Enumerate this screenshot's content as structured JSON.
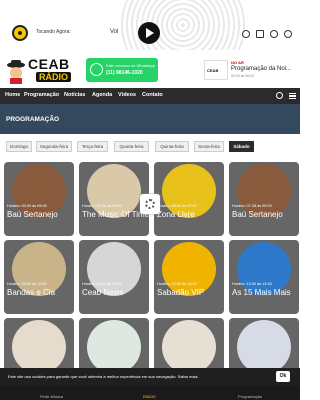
{
  "player": {
    "now_playing": "Tocando Agora:",
    "volume_label": "Vol"
  },
  "header": {
    "brand_main": "CEAB",
    "brand_sub": "RÁDIO",
    "whatsapp_line1": "Fale conosco no WhatsApp",
    "whatsapp_line2": "(11) 98146-1020",
    "onair_label": "NO AR",
    "onair_title": "Programação da Noi...",
    "onair_time": "00:00 às 06:00",
    "onair_thumb": "CEAB"
  },
  "nav": {
    "items": [
      "Home",
      "Programação",
      "Notícias",
      "Agenda",
      "Vídeos",
      "Contato"
    ]
  },
  "page": {
    "title": "PROGRAMAÇÃO"
  },
  "tabs": [
    "Domingo",
    "Segunda-feira",
    "Terça-feira",
    "Quarta-feira",
    "Quinta-feira",
    "Sexta-feira",
    "Sábado"
  ],
  "active_tab": "Sábado",
  "cards": [
    {
      "time": "Horário: 00:00 às 05:00",
      "name": "Baú Sertanejo"
    },
    {
      "time": "Horário: 04:00 às 05:00",
      "name": "The Music Of Time"
    },
    {
      "time": "Horário: 05:00 às 07:07",
      "name": "Zona Livre"
    },
    {
      "time": "Horário: 07:28 às 09:00",
      "name": "Baú Sertanejo"
    },
    {
      "time": "Horário: 09:00 às 11:00",
      "name": "Bandas e Cia"
    },
    {
      "time": "Horário: 11:00 às 12:00",
      "name": "Ceab News"
    },
    {
      "time": "Horário: 12:00 às 13:00",
      "name": "Sabadão VIP"
    },
    {
      "time": "Horário: 13:00 às 13:45",
      "name": "As 15 Mais Mais"
    },
    {
      "time": "",
      "name": ""
    },
    {
      "time": "",
      "name": ""
    },
    {
      "time": "",
      "name": ""
    },
    {
      "time": "",
      "name": ""
    }
  ],
  "cookie": {
    "text": "Este site usa cookies para garantir que você obtenha a melhor experiência em sua navegação. Saiba mais.",
    "ok": "Ok"
  },
  "bottom": {
    "items": [
      "Pedir Música",
      "RÁDIO",
      "Programação"
    ]
  },
  "colors": {
    "accent": "#f6c700",
    "whatsapp": "#25d366",
    "nav_bg": "#2b2b2b",
    "hero_bg": "#34495e"
  }
}
